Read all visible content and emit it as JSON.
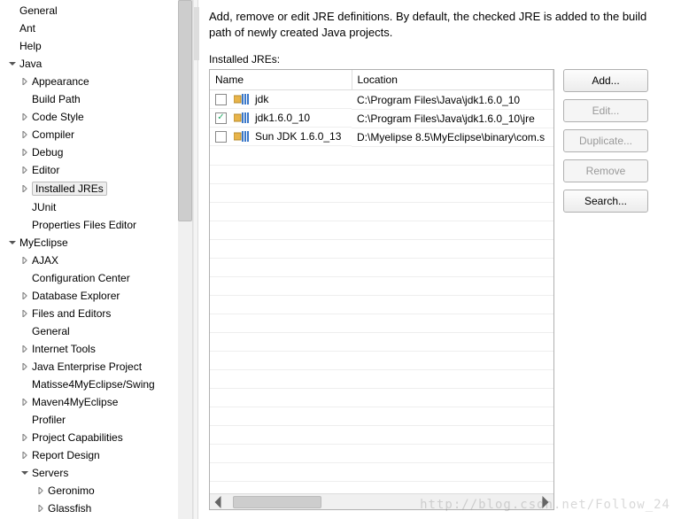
{
  "sidebar": {
    "items": [
      {
        "label": "General",
        "level": 1,
        "arrow": "none"
      },
      {
        "label": "Ant",
        "level": 1,
        "arrow": "none"
      },
      {
        "label": "Help",
        "level": 1,
        "arrow": "none"
      },
      {
        "label": "Java",
        "level": 1,
        "arrow": "down"
      },
      {
        "label": "Appearance",
        "level": 2,
        "arrow": "right"
      },
      {
        "label": "Build Path",
        "level": 2,
        "arrow": "none"
      },
      {
        "label": "Code Style",
        "level": 2,
        "arrow": "right"
      },
      {
        "label": "Compiler",
        "level": 2,
        "arrow": "right"
      },
      {
        "label": "Debug",
        "level": 2,
        "arrow": "right"
      },
      {
        "label": "Editor",
        "level": 2,
        "arrow": "right"
      },
      {
        "label": "Installed JREs",
        "level": 2,
        "arrow": "right",
        "selected": true
      },
      {
        "label": "JUnit",
        "level": 2,
        "arrow": "none"
      },
      {
        "label": "Properties Files Editor",
        "level": 2,
        "arrow": "none"
      },
      {
        "label": "MyEclipse",
        "level": 1,
        "arrow": "down"
      },
      {
        "label": "AJAX",
        "level": 2,
        "arrow": "right"
      },
      {
        "label": "Configuration Center",
        "level": 2,
        "arrow": "none"
      },
      {
        "label": "Database Explorer",
        "level": 2,
        "arrow": "right"
      },
      {
        "label": "Files and Editors",
        "level": 2,
        "arrow": "right"
      },
      {
        "label": "General",
        "level": 2,
        "arrow": "none"
      },
      {
        "label": "Internet Tools",
        "level": 2,
        "arrow": "right"
      },
      {
        "label": "Java Enterprise Project",
        "level": 2,
        "arrow": "right"
      },
      {
        "label": "Matisse4MyEclipse/Swing",
        "level": 2,
        "arrow": "none"
      },
      {
        "label": "Maven4MyEclipse",
        "level": 2,
        "arrow": "right"
      },
      {
        "label": "Profiler",
        "level": 2,
        "arrow": "none"
      },
      {
        "label": "Project Capabilities",
        "level": 2,
        "arrow": "right"
      },
      {
        "label": "Report Design",
        "level": 2,
        "arrow": "right"
      },
      {
        "label": "Servers",
        "level": 2,
        "arrow": "down"
      },
      {
        "label": "Geronimo",
        "level": 3,
        "arrow": "right"
      },
      {
        "label": "Glassfish",
        "level": 3,
        "arrow": "right"
      }
    ]
  },
  "main": {
    "description": "Add, remove or edit JRE definitions. By default, the checked JRE is added to the build path of newly created Java projects.",
    "section_label": "Installed JREs:",
    "columns": {
      "name": "Name",
      "location": "Location"
    },
    "rows": [
      {
        "checked": false,
        "name": "jdk",
        "location": "C:\\Program Files\\Java\\jdk1.6.0_10"
      },
      {
        "checked": true,
        "name": "jdk1.6.0_10",
        "location": "C:\\Program Files\\Java\\jdk1.6.0_10\\jre"
      },
      {
        "checked": false,
        "name": "Sun JDK 1.6.0_13",
        "location": "D:\\Myelipse 8.5\\MyEclipse\\binary\\com.s"
      }
    ],
    "buttons": {
      "add": "Add...",
      "edit": "Edit...",
      "duplicate": "Duplicate...",
      "remove": "Remove",
      "search": "Search..."
    }
  },
  "watermark": "http://blog.csdn.net/Follow_24"
}
